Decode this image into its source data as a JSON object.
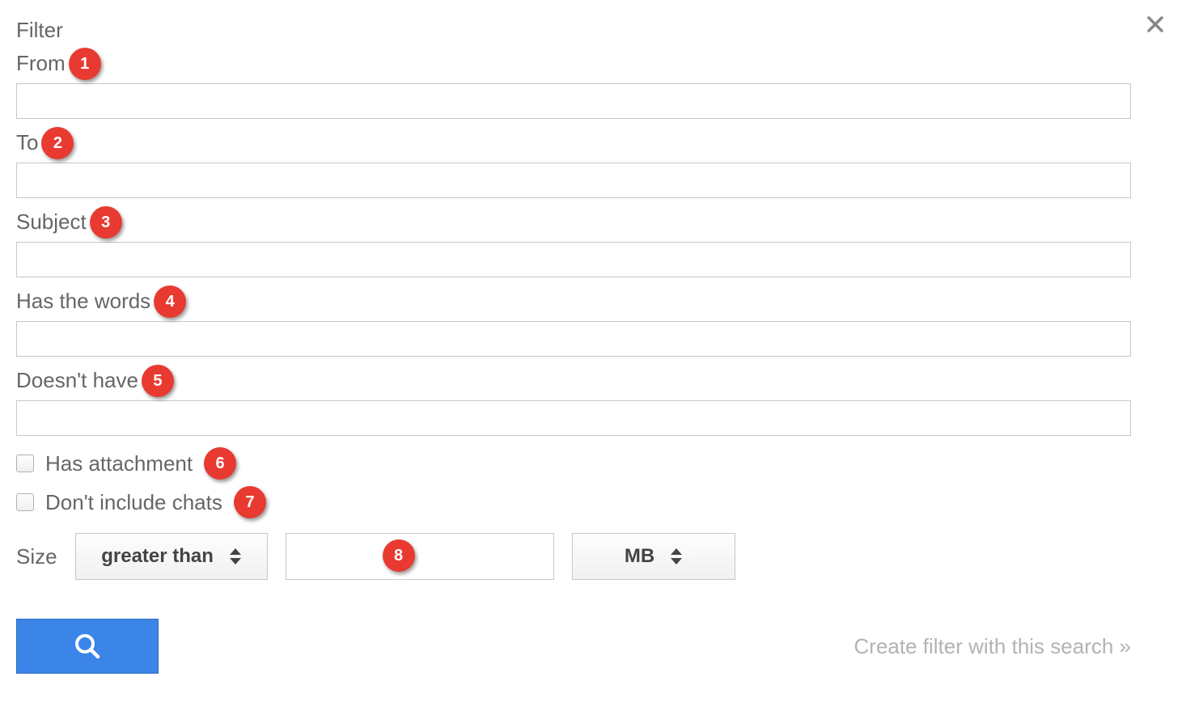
{
  "dialog": {
    "title": "Filter",
    "fields": {
      "from": {
        "label": "From",
        "value": ""
      },
      "to": {
        "label": "To",
        "value": ""
      },
      "subject": {
        "label": "Subject",
        "value": ""
      },
      "has_words": {
        "label": "Has the words",
        "value": ""
      },
      "doesnt_have": {
        "label": "Doesn't have",
        "value": ""
      }
    },
    "checkboxes": {
      "has_attachment": {
        "label": "Has attachment",
        "checked": false
      },
      "dont_include_chats": {
        "label": "Don't include chats",
        "checked": false
      }
    },
    "size": {
      "label": "Size",
      "compare_selected": "greater than",
      "value": "",
      "unit_selected": "MB"
    },
    "create_link": "Create filter with this search »"
  },
  "annotations": {
    "b1": "1",
    "b2": "2",
    "b3": "3",
    "b4": "4",
    "b5": "5",
    "b6": "6",
    "b7": "7",
    "b8": "8"
  }
}
